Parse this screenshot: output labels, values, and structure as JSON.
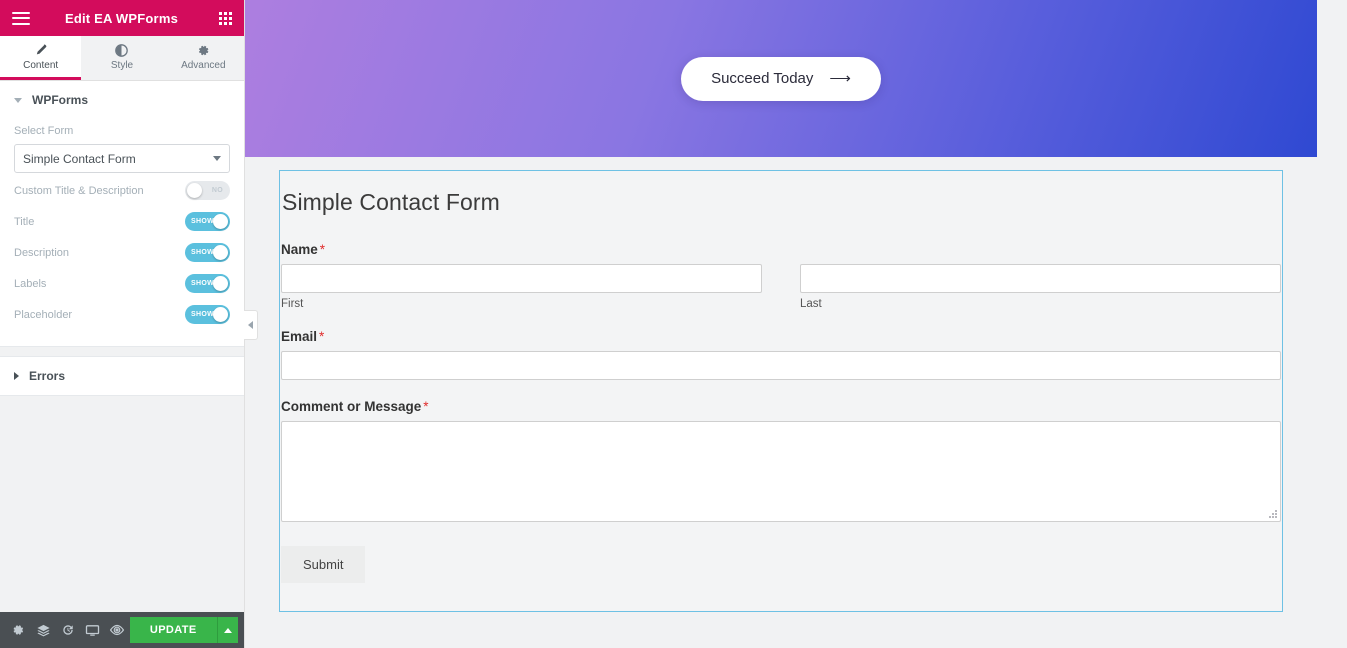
{
  "panel": {
    "header": {
      "title": "Edit EA WPForms",
      "menu_icon": "hamburger-icon",
      "apps_icon": "grid-apps-icon"
    },
    "tabs": [
      {
        "label": "Content",
        "icon": "pencil-icon",
        "active": true
      },
      {
        "label": "Style",
        "icon": "contrast-circle-icon",
        "active": false
      },
      {
        "label": "Advanced",
        "icon": "gear-icon",
        "active": false
      }
    ],
    "sections": [
      {
        "title": "WPForms",
        "expanded": true
      },
      {
        "title": "Errors",
        "expanded": false
      }
    ],
    "controls": {
      "select_form_label": "Select Form",
      "select_form_value": "Simple Contact Form",
      "toggles": [
        {
          "label": "Custom Title & Description",
          "state": "NO",
          "on": false
        },
        {
          "label": "Title",
          "state": "SHOW",
          "on": true
        },
        {
          "label": "Description",
          "state": "SHOW",
          "on": true
        },
        {
          "label": "Labels",
          "state": "SHOW",
          "on": true
        },
        {
          "label": "Placeholder",
          "state": "SHOW",
          "on": true
        }
      ]
    },
    "footer": {
      "icons": [
        "gear-icon",
        "layers-icon",
        "history-icon",
        "responsive-monitor-icon",
        "preview-eye-icon"
      ],
      "update_label": "UPDATE",
      "update_caret_icon": "chevron-up-icon",
      "update_color": "#39b54a"
    },
    "collapse_handle_icon": "chevron-left-icon"
  },
  "canvas": {
    "hero": {
      "cta_label": "Succeed Today",
      "cta_arrow_icon": "arrow-right-icon",
      "gradient_from": "#ad7ee0",
      "gradient_to": "#2f49d2"
    },
    "form": {
      "title": "Simple Contact Form",
      "selection_color": "#6ec1e4",
      "required_mark": "*",
      "fields": [
        {
          "label": "Name",
          "required": true,
          "type": "name",
          "parts": [
            {
              "sub_label": "First",
              "value": "",
              "placeholder": ""
            },
            {
              "sub_label": "Last",
              "value": "",
              "placeholder": ""
            }
          ]
        },
        {
          "label": "Email",
          "required": true,
          "type": "text",
          "value": "",
          "placeholder": ""
        },
        {
          "label": "Comment or Message",
          "required": true,
          "type": "textarea",
          "value": "",
          "placeholder": ""
        }
      ],
      "submit_label": "Submit"
    }
  }
}
